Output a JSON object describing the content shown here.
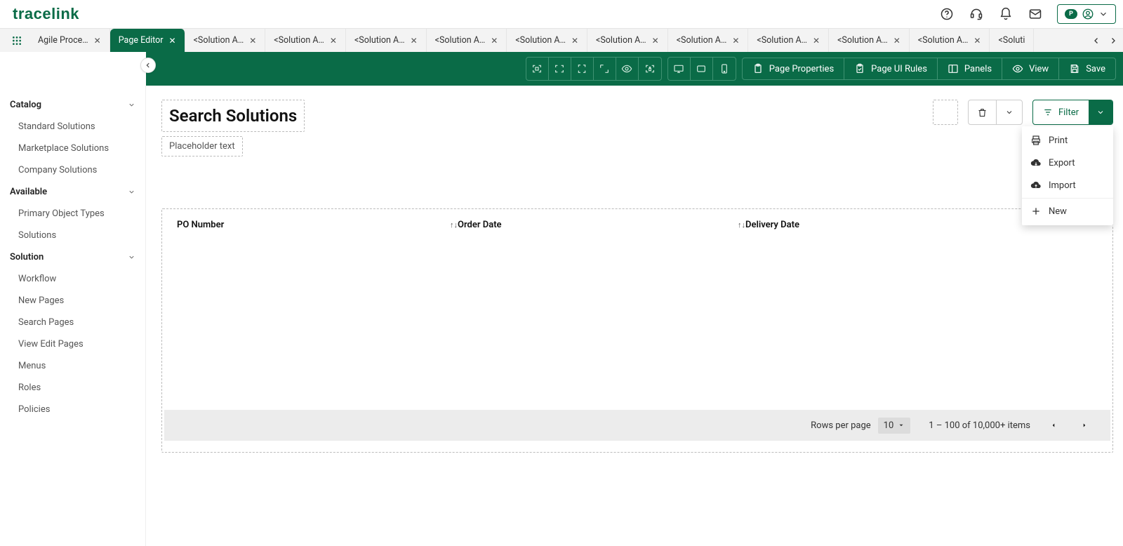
{
  "header": {
    "brand": "tracelink"
  },
  "tabs": {
    "active_index": 1,
    "items": [
      {
        "label": "Agile Proce…"
      },
      {
        "label": "Page Editor"
      },
      {
        "label": "<Solution A…"
      },
      {
        "label": "<Solution A…"
      },
      {
        "label": "<Solution A…"
      },
      {
        "label": "<Solution A…"
      },
      {
        "label": "<Solution A…"
      },
      {
        "label": "<Solution A…"
      },
      {
        "label": "<Solution A…"
      },
      {
        "label": "<Solution A…"
      },
      {
        "label": "<Solution A…"
      },
      {
        "label": "<Solution A…"
      },
      {
        "label": "<Soluti"
      }
    ]
  },
  "actionbar": {
    "page_properties": "Page Properties",
    "page_ui_rules": "Page UI Rules",
    "panels": "Panels",
    "view": "View",
    "save": "Save"
  },
  "sidebar": {
    "groups": [
      {
        "title": "Catalog",
        "items": [
          "Standard Solutions",
          "Marketplace Solutions",
          "Company Solutions"
        ]
      },
      {
        "title": "Available",
        "items": [
          "Primary Object Types",
          "Solutions"
        ]
      },
      {
        "title": "Solution",
        "items": [
          "Workflow",
          "New Pages",
          "Search Pages",
          "View Edit Pages",
          "Menus",
          "Roles",
          "Policies"
        ]
      }
    ]
  },
  "canvas": {
    "title": "Search Solutions",
    "subtitle": "Placeholder text",
    "filter_label": "Filter",
    "dropdown": {
      "print": "Print",
      "export": "Export",
      "import": "Import",
      "new": "New"
    },
    "table": {
      "columns": [
        "PO Number",
        "Order Date",
        "Delivery Date"
      ]
    },
    "pager": {
      "rows_label": "Rows per page",
      "rows_value": "10",
      "range_text": "1 – 100 of 10,000+ items"
    }
  }
}
